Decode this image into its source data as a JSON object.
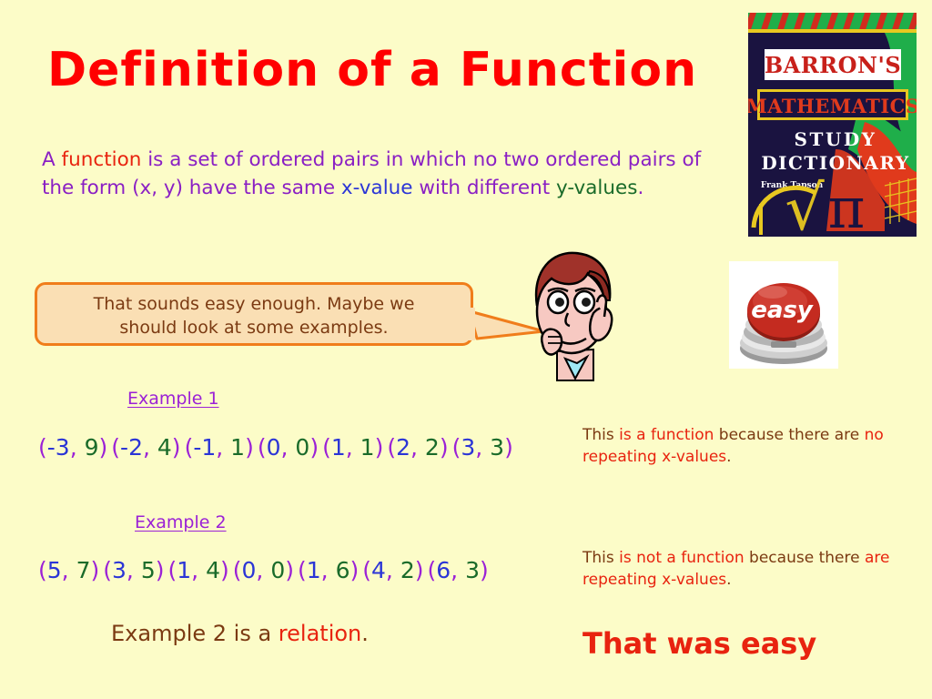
{
  "slide": {
    "background_color": "#FCFCC8",
    "title": "Definition of a Function",
    "title_color": "#FF0000"
  },
  "definition": {
    "seg1": "A ",
    "word_function": "function",
    "seg2": " is a set of ordered pairs in which no two ordered pairs of the form (x, y) have the same ",
    "word_xvalue": "x-value",
    "seg3": " with different ",
    "word_yvalues": "y-values",
    "seg4": ".",
    "text_color": "#8A1FC4",
    "function_color": "#E8230F",
    "x_color": "#2B35D6",
    "y_color": "#1A6B2A"
  },
  "speech_bubble": {
    "line1": "That sounds easy enough.  Maybe we",
    "line2": "should look at some examples.",
    "fill_color": "#FADFB4",
    "border_color": "#F07D1B",
    "text_color": "#7B3A12"
  },
  "book_cover": {
    "brand": "BARRON'S",
    "subject": "MATHEMATICS",
    "type_line1": "STUDY",
    "type_line2": "DICTIONARY",
    "author": "Frank Tapson",
    "symbol_pi": "π",
    "symbol_radical": "√"
  },
  "easy_button": {
    "label": "easy",
    "button_color": "#C42B20",
    "base_color": "#B8B8B8"
  },
  "examples": [
    {
      "label": "Example 1",
      "pairs": [
        {
          "x": "-3",
          "y": "9"
        },
        {
          "x": "-2",
          "y": "4"
        },
        {
          "x": "-1",
          "y": "1"
        },
        {
          "x": "0",
          "y": "0"
        },
        {
          "x": "1",
          "y": "1"
        },
        {
          "x": "2",
          "y": "2"
        },
        {
          "x": "3",
          "y": "3"
        }
      ],
      "note_plain1": "This ",
      "note_hl1": "is a function",
      "note_plain2": " because there are ",
      "note_hl2": "no repeating x-values",
      "note_plain3": "."
    },
    {
      "label": "Example 2",
      "pairs": [
        {
          "x": "5",
          "y": "7"
        },
        {
          "x": "3",
          "y": "5"
        },
        {
          "x": "1",
          "y": "4"
        },
        {
          "x": "0",
          "y": "0"
        },
        {
          "x": "1",
          "y": "6"
        },
        {
          "x": "4",
          "y": "2"
        },
        {
          "x": "6",
          "y": "3"
        }
      ],
      "note_plain1": "This ",
      "note_hl1": "is not a function",
      "note_plain2": " because there ",
      "note_hl2": "are repeating x-values",
      "note_plain3": "."
    }
  ],
  "conclusion": {
    "relation_plain": "Example 2 is a ",
    "relation_hl": "relation",
    "relation_end": ".",
    "that_was_easy": "That was easy"
  }
}
